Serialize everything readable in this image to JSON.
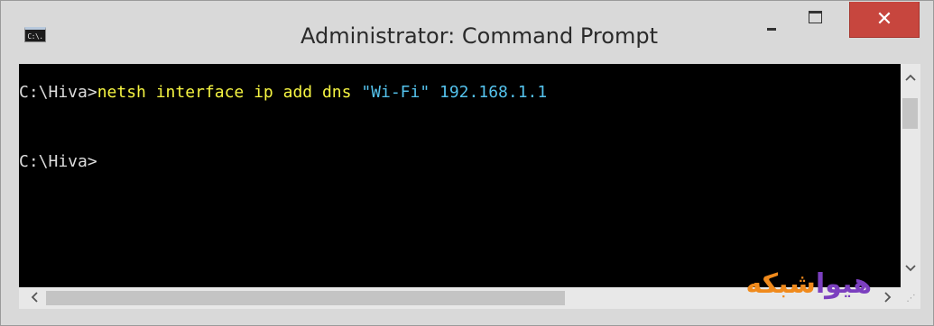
{
  "window": {
    "title": "Administrator: Command Prompt",
    "app_icon_text": "C:\\.",
    "close_symbol": "✕"
  },
  "console": {
    "line1": {
      "prompt": "C:\\Hiva>",
      "command": "netsh interface ip add dns ",
      "string_arg": "\"Wi-Fi\"",
      "number_arg": " 192.168.1.1"
    },
    "line2": {
      "prompt": "C:\\Hiva>"
    }
  },
  "scrollbars": {
    "up_arrow": "^",
    "down_arrow": "v",
    "left_arrow": "<",
    "right_arrow": ">",
    "grip": "⋰"
  },
  "watermark": {
    "part1": "هیوا",
    "part2": "شبکه",
    "colors": {
      "part1": "#7b3fbf",
      "part2": "#f08a1c"
    }
  },
  "colors": {
    "console_bg": "#000000",
    "command_text": "#f6f542",
    "arg_text": "#54c2ec",
    "close_button": "#c7463e"
  }
}
